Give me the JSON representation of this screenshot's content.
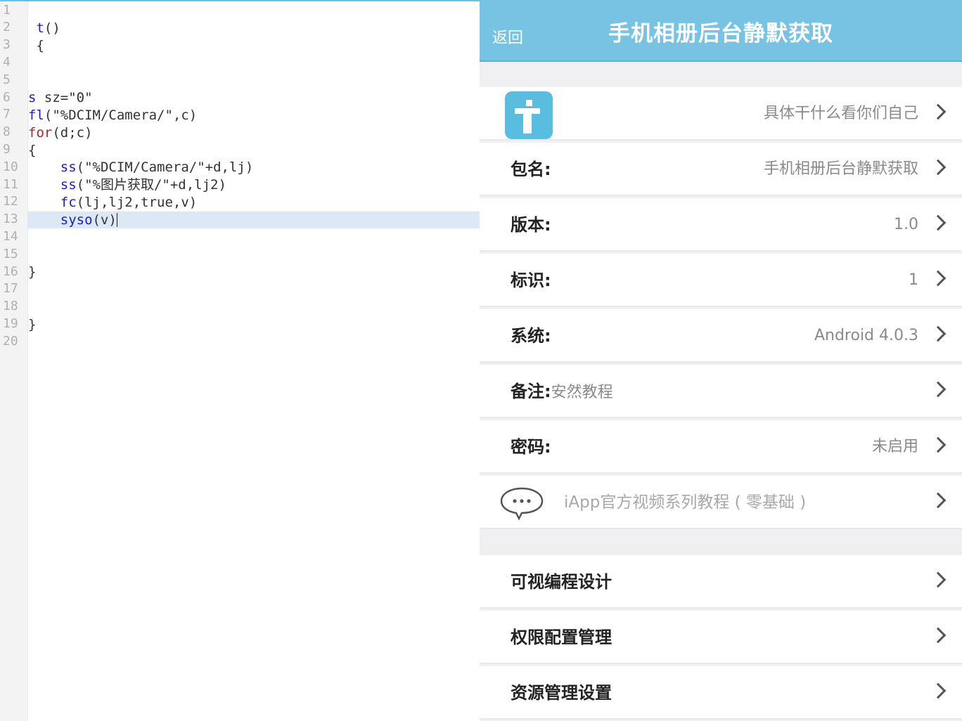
{
  "editor": {
    "line_numbers": [
      "1",
      "2",
      "3",
      "4",
      "5",
      "6",
      "7",
      "8",
      "9",
      "10",
      "11",
      "12",
      "13",
      "14",
      "15",
      "16",
      "17",
      "18",
      "19",
      "20"
    ],
    "lines": {
      "l1": "",
      "l2_fn": "t",
      "l2_rest": "()",
      "l3": " {",
      "l6_kw": "s",
      "l6_rest": " sz=\"0\"",
      "l7_kw": "fl",
      "l7_rest": "(\"%DCIM/Camera/\",c)",
      "l8_kw": "for",
      "l8_rest": "(d;c)",
      "l9": "{",
      "l10_kw": "ss",
      "l10_rest": "(\"%DCIM/Camera/\"+d,lj)",
      "l11_kw": "ss",
      "l11_rest": "(\"%图片获取/\"+d,lj2)",
      "l12_kw": "fc",
      "l12_rest": "(lj,lj2,true,v)",
      "l13_kw": "syso",
      "l13_rest": "(v)",
      "l16": "}",
      "l19": "}"
    }
  },
  "phone": {
    "back_label": "返回",
    "title": "手机相册后台静默获取",
    "info_row_value": "具体干什么看你们自己",
    "fields": {
      "package_label": "包名:",
      "package_value": "手机相册后台静默获取",
      "version_label": "版本:",
      "version_value": "1.0",
      "id_label": "标识:",
      "id_value": "1",
      "system_label": "系统:",
      "system_value": "Android 4.0.3",
      "note_label": "备注:",
      "note_value": "安然教程",
      "password_label": "密码:",
      "password_value": "未启用"
    },
    "video_label": "iApp官方视频系列教程 ( 零基础 )",
    "menu": {
      "visual_design": "可视编程设计",
      "permissions": "权限配置管理",
      "resources": "资源管理设置"
    }
  },
  "colors": {
    "topbar": "#76c3e3",
    "info_icon": "#59bde0",
    "keyword_blue": "#1c1cc0",
    "keyword_red": "#9c2a32",
    "current_line": "#dde8f6"
  },
  "icons": {
    "info": "info-icon",
    "chat": "chat-bubble-icon",
    "chevron": "chevron-right-icon"
  }
}
